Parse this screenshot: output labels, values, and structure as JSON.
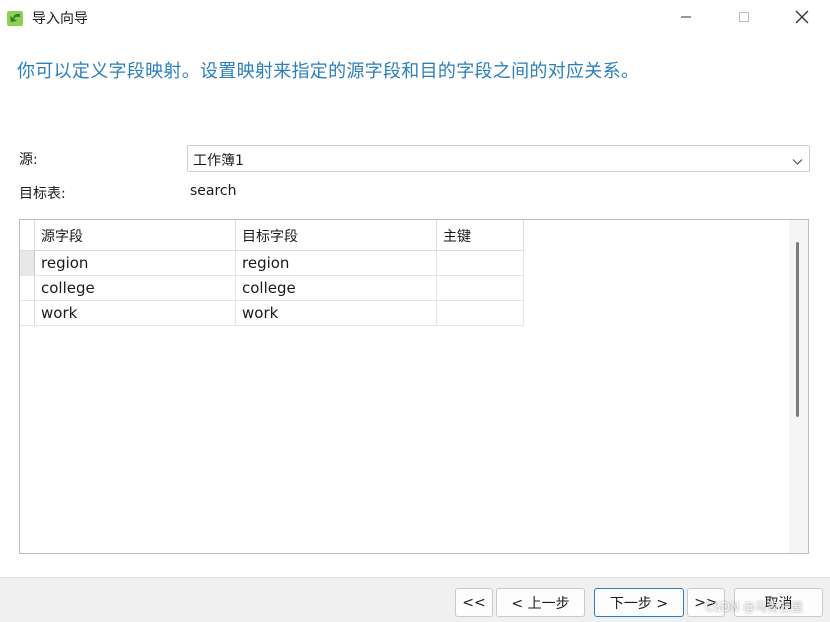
{
  "window": {
    "title": "导入向导",
    "icon": "import-wizard-icon",
    "controls": [
      "minimize-icon",
      "maximize-icon",
      "close-icon"
    ]
  },
  "instruction": "你可以定义字段映射。设置映射来指定的源字段和目的字段之间的对应关系。",
  "source": {
    "label": "源:",
    "value": "工作簿1"
  },
  "target": {
    "label": "目标表:",
    "value": "search"
  },
  "mapping": {
    "columns": [
      "源字段",
      "目标字段",
      "主键"
    ],
    "rows": [
      {
        "source": "region",
        "target": "region",
        "key": ""
      },
      {
        "source": "college",
        "target": "college",
        "key": ""
      },
      {
        "source": "work",
        "target": "work",
        "key": ""
      }
    ]
  },
  "buttons": {
    "first": "<<",
    "prev": "< 上一步",
    "next": "下一步 >",
    "last": ">>",
    "cancel": "取消"
  },
  "watermark": "CSDN @马肯云屋",
  "colors": {
    "instruction_text": "#2a7fc0",
    "primary_border": "#2a7fc0",
    "footer_bg": "#f0f0f0"
  }
}
